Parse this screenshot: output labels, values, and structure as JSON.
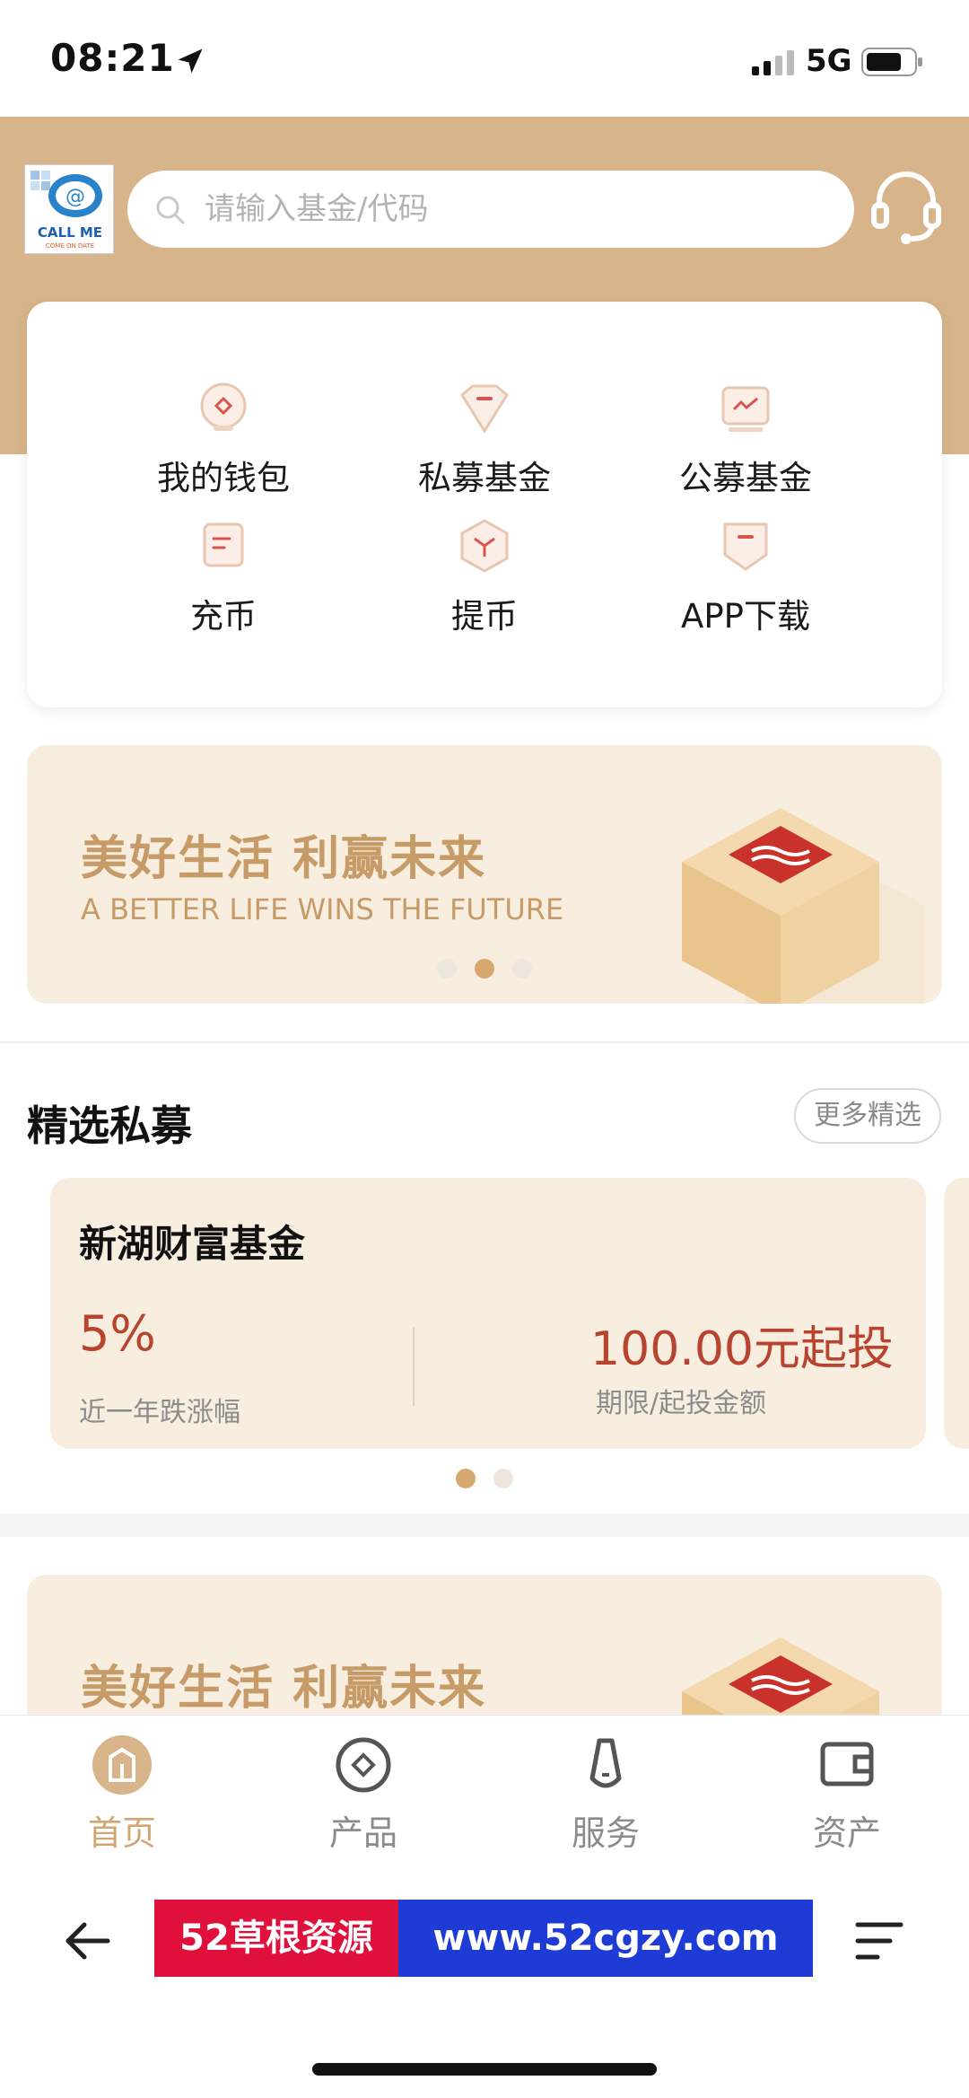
{
  "status_bar": {
    "time": "08:21",
    "network": "5G"
  },
  "header": {
    "logo_text": "CALL ME",
    "logo_subtext": "COME ON DATE"
  },
  "search": {
    "placeholder": "请输入基金/代码"
  },
  "quick_menu": {
    "items": [
      {
        "label": "我的钱包",
        "icon": "wallet-icon"
      },
      {
        "label": "私募基金",
        "icon": "private-fund-icon"
      },
      {
        "label": "公募基金",
        "icon": "public-fund-icon"
      },
      {
        "label": "充币",
        "icon": "deposit-icon"
      },
      {
        "label": "提币",
        "icon": "withdraw-icon"
      },
      {
        "label": "APP下载",
        "icon": "download-icon"
      }
    ]
  },
  "banner": {
    "title": "美好生活 利赢未来",
    "subtitle": "A BETTER LIFE WINS THE FUTURE"
  },
  "featured": {
    "title": "精选私募",
    "more_label": "更多精选",
    "fund": {
      "name": "新湖财富基金",
      "rate": "5%",
      "rate_label": "近一年跌涨幅",
      "min_invest": "100.00元起投",
      "min_invest_label": "期限/起投金额"
    }
  },
  "tabbar": {
    "tabs": [
      {
        "label": "首页",
        "active": true
      },
      {
        "label": "产品",
        "active": false
      },
      {
        "label": "服务",
        "active": false
      },
      {
        "label": "资产",
        "active": false
      }
    ]
  },
  "browser": {
    "ad_left": "52草根资源",
    "ad_right": "www.52cgzy.com"
  },
  "colors": {
    "gold": "#d8b48a",
    "accent": "#d1a672",
    "rate_red": "#b8432e",
    "banner_bg": "#f8eee0"
  }
}
